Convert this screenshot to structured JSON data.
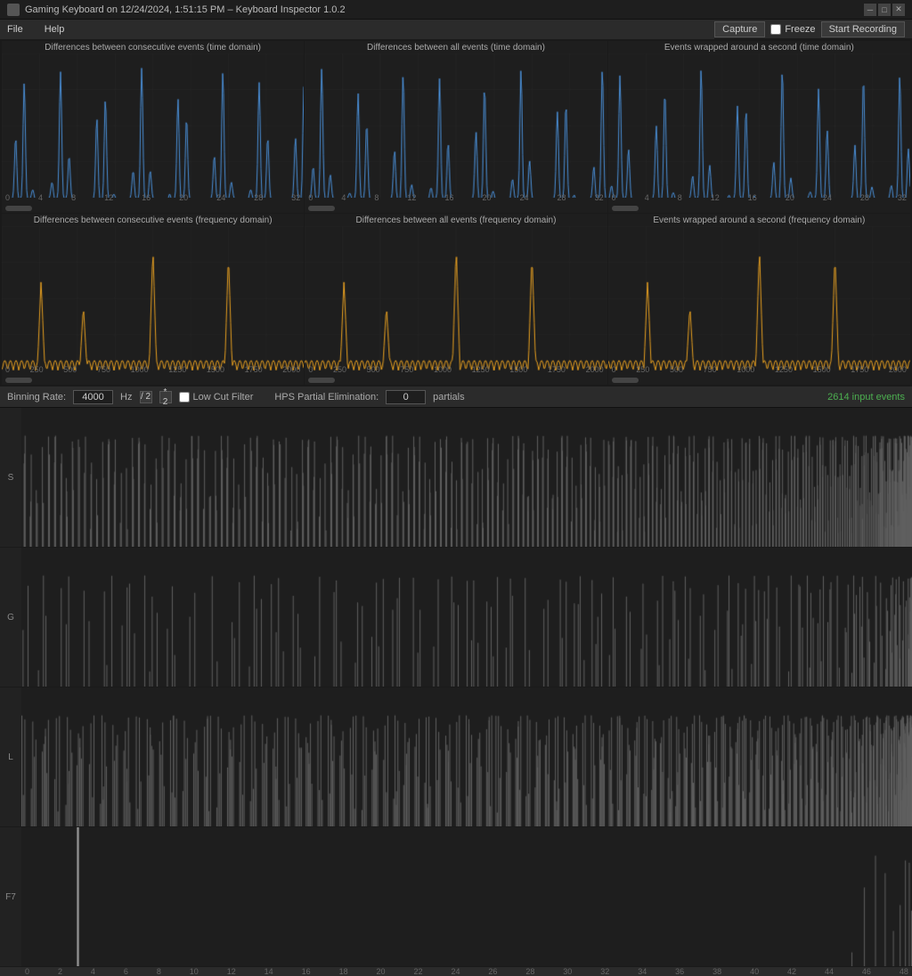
{
  "titleBar": {
    "title": "Gaming Keyboard on 12/24/2024, 1:51:15 PM – Keyboard Inspector 1.0.2",
    "controls": [
      "minimize",
      "maximize",
      "close"
    ]
  },
  "menuBar": {
    "items": [
      "File",
      "Help"
    ]
  },
  "toolbar": {
    "captureLabel": "Capture",
    "freezeLabel": "Freeze",
    "startRecordingLabel": "Start Recording"
  },
  "charts": {
    "topRow": [
      {
        "title": "Differences between consecutive events (time domain)",
        "color": "#4a90d9",
        "type": "time"
      },
      {
        "title": "Differences between all events (time domain)",
        "color": "#4a90d9",
        "type": "time"
      },
      {
        "title": "Events wrapped around a second (time domain)",
        "color": "#4a90d9",
        "type": "time"
      }
    ],
    "bottomRow": [
      {
        "title": "Differences between consecutive events (frequency domain)",
        "color": "#e8a020",
        "type": "freq"
      },
      {
        "title": "Differences between all events (frequency domain)",
        "color": "#e8a020",
        "type": "freq"
      },
      {
        "title": "Events wrapped around a second (frequency domain)",
        "color": "#e8a020",
        "type": "freq"
      }
    ],
    "timeAxisLabels": [
      "0",
      "4",
      "8",
      "12",
      "16",
      "20",
      "24",
      "28",
      "32"
    ],
    "freqAxisLabels": [
      "0",
      "250",
      "500",
      "750",
      "1000",
      "1250",
      "1500",
      "1750",
      "2000"
    ]
  },
  "bottomControls": {
    "binningRateLabel": "Binning Rate:",
    "binningRateValue": "4000",
    "binningRateUnit": "Hz",
    "divideBtn": "/ 2",
    "multiplyBtn": "* 2",
    "lowCutFilterLabel": "Low Cut Filter",
    "hpsLabel": "HPS Partial Elimination:",
    "hpsValue": "0",
    "hpsUnit": "partials",
    "inputEventsText": "2614 input events"
  },
  "lanes": [
    {
      "label": "S",
      "density": "high"
    },
    {
      "label": "G",
      "density": "medium"
    },
    {
      "label": "L",
      "density": "high"
    },
    {
      "label": "F7",
      "density": "low"
    }
  ],
  "timeAxis": {
    "labels": [
      "0",
      "2",
      "4",
      "6",
      "8",
      "10",
      "12",
      "14",
      "16",
      "18",
      "20",
      "22",
      "24",
      "26",
      "28",
      "30",
      "32",
      "34",
      "36",
      "38",
      "40",
      "42",
      "44",
      "46",
      "48"
    ]
  }
}
